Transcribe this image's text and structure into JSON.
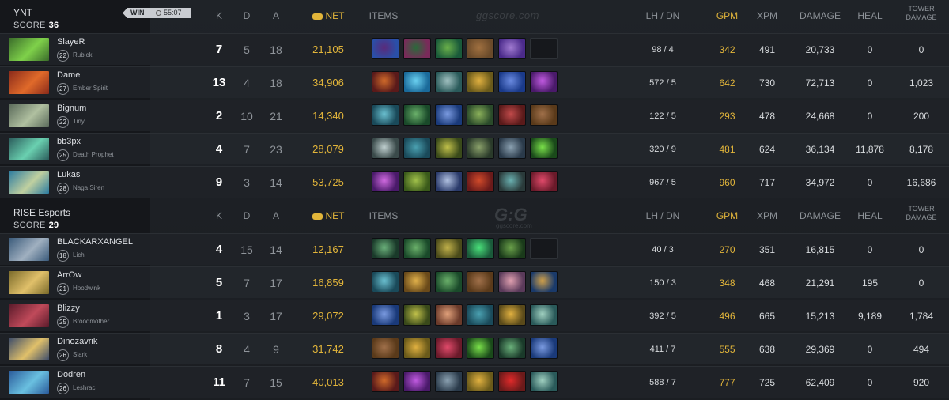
{
  "header": {
    "k": "K",
    "d": "D",
    "a": "A",
    "net": "NET",
    "items": "ITEMS",
    "lh_dn": "LH / DN",
    "gpm": "GPM",
    "xpm": "XPM",
    "damage": "DAMAGE",
    "heal": "HEAL",
    "tower_damage_1": "TOWER",
    "tower_damage_2": "DAMAGE"
  },
  "watermark": {
    "text": "ggscore.com",
    "logo": "G:G",
    "logo_sub": "ggscore.com"
  },
  "match": {
    "result": "WIN",
    "duration": "55:07"
  },
  "teams": [
    {
      "name": "YNT",
      "score_label": "SCORE",
      "score": "36",
      "players": [
        {
          "name": "SlayeR",
          "level": "22",
          "hero": "Rubick",
          "k": "7",
          "d": "5",
          "a": "18",
          "net": "21,105",
          "lh_dn": "98  /  4",
          "gpm": "342",
          "xpm": "491",
          "damage": "20,733",
          "heal": "0",
          "tower": "0",
          "portrait": [
            "#3a6b2a",
            "#7fd14a"
          ],
          "items": [
            [
              "#2a4fa8",
              "#5a2a7a"
            ],
            [
              "#7a2a5a",
              "#2a6a3a"
            ],
            [
              "#1a5a3a",
              "#6ab04a"
            ],
            [
              "#6a4a2a",
              "#a07040"
            ],
            [
              "#4a2a8a",
              "#a07ad0"
            ],
            null
          ]
        },
        {
          "name": "Dame",
          "level": "27",
          "hero": "Ember Spirit",
          "k": "13",
          "d": "4",
          "a": "18",
          "net": "34,906",
          "lh_dn": "572  /  5",
          "gpm": "642",
          "xpm": "730",
          "damage": "72,713",
          "heal": "0",
          "tower": "1,023",
          "portrait": [
            "#8a2a1a",
            "#e06a2a"
          ],
          "items": [
            [
              "#5a1a1a",
              "#d06a2a"
            ],
            [
              "#1a6a9a",
              "#6ad0f0"
            ],
            [
              "#2a5a5a",
              "#a0c0c0"
            ],
            [
              "#6a5a1a",
              "#e0b040"
            ],
            [
              "#1a3a8a",
              "#6a8ae0"
            ],
            [
              "#4a1a6a",
              "#c05ae0"
            ]
          ]
        },
        {
          "name": "Bignum",
          "level": "22",
          "hero": "Tiny",
          "k": "2",
          "d": "10",
          "a": "21",
          "net": "14,340",
          "lh_dn": "122  /  5",
          "gpm": "293",
          "xpm": "478",
          "damage": "24,668",
          "heal": "0",
          "tower": "200",
          "portrait": [
            "#5a6a5a",
            "#b0c0a0"
          ],
          "items": [
            [
              "#1a4a5a",
              "#6ac0d0"
            ],
            [
              "#1a4a2a",
              "#6ab06a"
            ],
            [
              "#1a3a7a",
              "#7a9ae0"
            ],
            [
              "#2a4a2a",
              "#8ab05a"
            ],
            [
              "#5a1a1a",
              "#c04a4a"
            ],
            [
              "#5a3a1a",
              "#a0704a"
            ]
          ]
        },
        {
          "name": "bb3px",
          "level": "25",
          "hero": "Death Prophet",
          "k": "4",
          "d": "7",
          "a": "23",
          "net": "28,079",
          "lh_dn": "320  /  9",
          "gpm": "481",
          "xpm": "624",
          "damage": "36,134",
          "heal": "11,878",
          "tower": "8,178",
          "portrait": [
            "#2a5a5a",
            "#6ad0b0"
          ],
          "items": [
            [
              "#3a4a4a",
              "#c0d0d0"
            ],
            [
              "#1a4a5a",
              "#4aa0b0"
            ],
            [
              "#3a4a1a",
              "#c0c04a"
            ],
            [
              "#2a3a2a",
              "#8aa06a"
            ],
            [
              "#2a3a4a",
              "#8aa0b0"
            ],
            [
              "#1a4a1a",
              "#7ae04a"
            ]
          ]
        },
        {
          "name": "Lukas",
          "level": "28",
          "hero": "Naga Siren",
          "k": "9",
          "d": "3",
          "a": "14",
          "net": "53,725",
          "lh_dn": "967  /  5",
          "gpm": "960",
          "xpm": "717",
          "damage": "34,972",
          "heal": "0",
          "tower": "16,686",
          "portrait": [
            "#2a7aa0",
            "#c0d0a0"
          ],
          "items": [
            [
              "#4a1a6a",
              "#d06ae0"
            ],
            [
              "#3a5a1a",
              "#a0c04a"
            ],
            [
              "#2a3a6a",
              "#b0c0e0"
            ],
            [
              "#6a1a1a",
              "#d04a2a"
            ],
            [
              "#2a3a3a",
              "#6ab0b0"
            ],
            [
              "#6a1a2a",
              "#e04a6a"
            ]
          ]
        }
      ]
    },
    {
      "name": "RISE Esports",
      "score_label": "SCORE",
      "score": "29",
      "players": [
        {
          "name": "BLACKARXANGEL",
          "level": "18",
          "hero": "Lich",
          "k": "4",
          "d": "15",
          "a": "14",
          "net": "12,167",
          "lh_dn": "40  /  3",
          "gpm": "270",
          "xpm": "351",
          "damage": "16,815",
          "heal": "0",
          "tower": "0",
          "portrait": [
            "#3a5a7a",
            "#a0b0c0"
          ],
          "items": [
            [
              "#1a3a2a",
              "#6ab07a"
            ],
            [
              "#1a4a2a",
              "#6ab06a"
            ],
            [
              "#4a4a1a",
              "#c0b04a"
            ],
            [
              "#1a5a3a",
              "#4ae07a"
            ],
            [
              "#1a3a1a",
              "#6aa04a"
            ],
            null
          ]
        },
        {
          "name": "ArrOw",
          "level": "21",
          "hero": "Hoodwink",
          "k": "5",
          "d": "7",
          "a": "17",
          "net": "16,859",
          "lh_dn": "150  /  3",
          "gpm": "348",
          "xpm": "468",
          "damage": "21,291",
          "heal": "195",
          "tower": "0",
          "portrait": [
            "#7a6a2a",
            "#e0c06a"
          ],
          "items": [
            [
              "#1a4a5a",
              "#6ac0d0"
            ],
            [
              "#6a4a1a",
              "#e0b04a"
            ],
            [
              "#1a4a2a",
              "#6ab06a"
            ],
            [
              "#5a3a1a",
              "#a0704a"
            ],
            [
              "#5a3a5a",
              "#e0a0b0"
            ],
            [
              "#1a3a6a",
              "#d0a04a"
            ]
          ]
        },
        {
          "name": "Blizzy",
          "level": "25",
          "hero": "Broodmother",
          "k": "1",
          "d": "3",
          "a": "17",
          "net": "29,072",
          "lh_dn": "392  /  5",
          "gpm": "496",
          "xpm": "665",
          "damage": "15,213",
          "heal": "9,189",
          "tower": "1,784",
          "portrait": [
            "#5a1a2a",
            "#c04a5a"
          ],
          "items": [
            [
              "#1a3a7a",
              "#7a9ae0"
            ],
            [
              "#3a4a1a",
              "#c0c04a"
            ],
            [
              "#6a3a2a",
              "#e0a07a"
            ],
            [
              "#1a4a5a",
              "#4aa0b0"
            ],
            [
              "#5a4a1a",
              "#e0b040"
            ],
            [
              "#2a5a5a",
              "#a0d0c0"
            ]
          ]
        },
        {
          "name": "Dinozavrik",
          "level": "26",
          "hero": "Slark",
          "k": "8",
          "d": "4",
          "a": "9",
          "net": "31,742",
          "lh_dn": "411  /  7",
          "gpm": "555",
          "xpm": "638",
          "damage": "29,369",
          "heal": "0",
          "tower": "494",
          "portrait": [
            "#3a4a6a",
            "#e0c06a"
          ],
          "items": [
            [
              "#5a3a1a",
              "#a0704a"
            ],
            [
              "#6a5a1a",
              "#e0b040"
            ],
            [
              "#6a1a2a",
              "#e04a6a"
            ],
            [
              "#1a4a1a",
              "#7ae04a"
            ],
            [
              "#1a3a2a",
              "#6ab07a"
            ],
            [
              "#1a3a7a",
              "#7a9ae0"
            ]
          ]
        },
        {
          "name": "Dodren",
          "level": "26",
          "hero": "Leshrac",
          "k": "11",
          "d": "7",
          "a": "15",
          "net": "40,013",
          "lh_dn": "588  /  7",
          "gpm": "777",
          "xpm": "725",
          "damage": "62,409",
          "heal": "0",
          "tower": "920",
          "portrait": [
            "#2a5a9a",
            "#6ac0e0"
          ],
          "items": [
            [
              "#5a1a1a",
              "#d06a2a"
            ],
            [
              "#4a1a6a",
              "#c05ae0"
            ],
            [
              "#2a3a4a",
              "#8aa0b0"
            ],
            [
              "#6a5a1a",
              "#e0b040"
            ],
            [
              "#6a1a1a",
              "#e02a2a"
            ],
            [
              "#2a5a5a",
              "#a0d0c0"
            ]
          ]
        }
      ]
    }
  ]
}
